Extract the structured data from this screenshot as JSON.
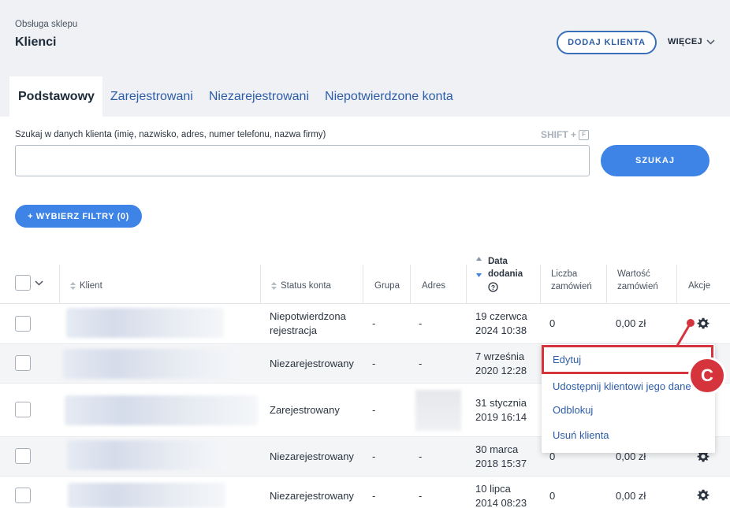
{
  "header": {
    "breadcrumb": "Obsługa sklepu",
    "title": "Klienci",
    "add_button": "DODAJ KLIENTA",
    "more_button": "WIĘCEJ"
  },
  "tabs": [
    {
      "label": "Podstawowy",
      "active": true
    },
    {
      "label": "Zarejestrowani",
      "active": false
    },
    {
      "label": "Niezarejestrowani",
      "active": false
    },
    {
      "label": "Niepotwierdzone konta",
      "active": false
    }
  ],
  "search": {
    "label": "Szukaj w danych klienta (imię, nazwisko, adres, numer telefonu, nazwa firmy)",
    "shortcut_text": "SHIFT +",
    "shortcut_key": "F",
    "value": "",
    "button": "SZUKAJ"
  },
  "filters_button": "+ WYBIERZ FILTRY (0)",
  "table": {
    "columns": {
      "client": "Klient",
      "status": "Status konta",
      "group": "Grupa",
      "address": "Adres",
      "date_line1": "Data",
      "date_line2": "dodania",
      "orders_line1": "Liczba",
      "orders_line2": "zamówień",
      "value_line1": "Wartość",
      "value_line2": "zamówień",
      "actions": "Akcje"
    },
    "rows": [
      {
        "status_line1": "Niepotwierdzona",
        "status_line2": "rejestracja",
        "group": "-",
        "address": "-",
        "date_line1": "19 czerwca",
        "date_line2": "2024 10:38",
        "orders": "0",
        "value": "0,00 zł"
      },
      {
        "status_line1": "Niezarejestrowany",
        "status_line2": "",
        "group": "-",
        "address": "-",
        "date_line1": "7 września",
        "date_line2": "2020 12:28",
        "orders": "",
        "value": ""
      },
      {
        "status_line1": "Zarejestrowany",
        "status_line2": "",
        "group": "-",
        "address": "",
        "date_line1": "31 stycznia",
        "date_line2": "2019 16:14",
        "orders": "",
        "value": ""
      },
      {
        "status_line1": "Niezarejestrowany",
        "status_line2": "",
        "group": "-",
        "address": "-",
        "date_line1": "30 marca",
        "date_line2": "2018 15:37",
        "orders": "0",
        "value": "0,00 zł"
      },
      {
        "status_line1": "Niezarejestrowany",
        "status_line2": "",
        "group": "-",
        "address": "-",
        "date_line1": "10 lipca",
        "date_line2": "2014 08:23",
        "orders": "0",
        "value": "0,00 zł"
      }
    ]
  },
  "actions_menu": {
    "items": [
      "Edytuj",
      "Udostępnij klientowi jego dane",
      "Odblokuj",
      "Usuń klienta"
    ]
  },
  "callout": "C",
  "colors": {
    "accent": "#3d84e6",
    "link": "#2d5da8",
    "highlight": "#d6343d"
  }
}
